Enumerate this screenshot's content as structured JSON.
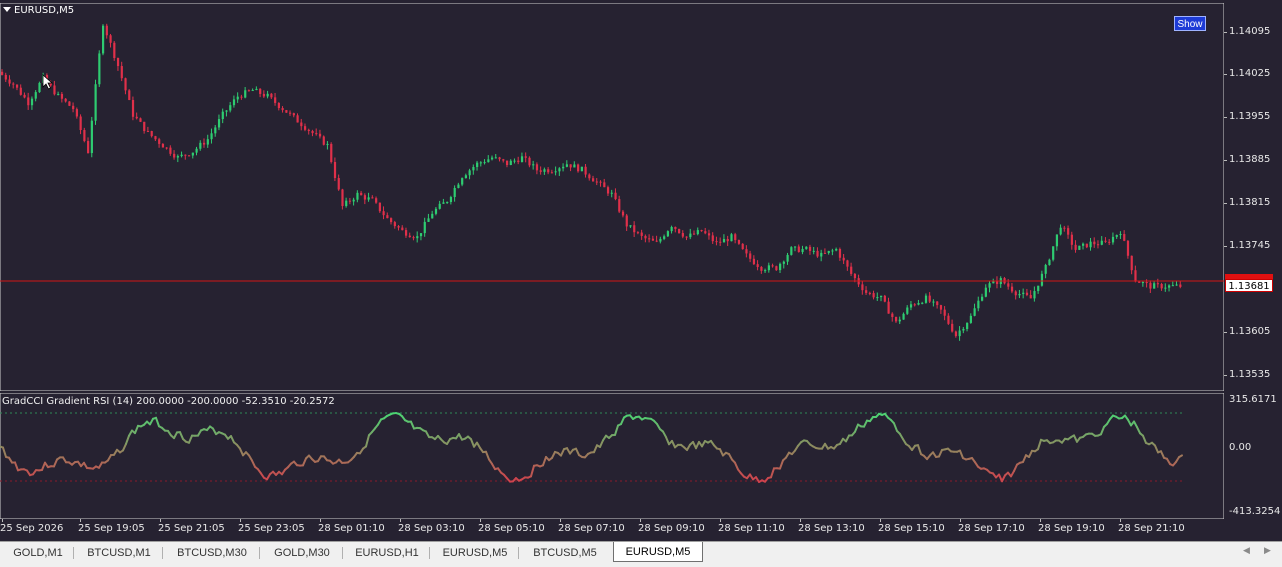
{
  "chart": {
    "title": "EURUSD,M5",
    "show_button": "Show",
    "current_price": "1.13681",
    "bull_color": "#2ecc71",
    "bear_color": "#e0304a",
    "background": "#262231"
  },
  "indicator": {
    "title": "GradCCI Gradient RSI (14) 200.0000 -200.0000 -52.3510 -20.2572",
    "axis_labels": [
      "315.6171",
      "0.00",
      "-413.3254"
    ]
  },
  "price_axis": [
    "1.14095",
    "1.14025",
    "1.13955",
    "1.13885",
    "1.13815",
    "1.13745",
    "1.13605",
    "1.13535"
  ],
  "time_axis": [
    "25 Sep 2026",
    "25 Sep 19:05",
    "25 Sep 21:05",
    "25 Sep 23:05",
    "28 Sep 01:10",
    "28 Sep 03:10",
    "28 Sep 05:10",
    "28 Sep 07:10",
    "28 Sep 09:10",
    "28 Sep 11:10",
    "28 Sep 13:10",
    "28 Sep 15:10",
    "28 Sep 17:10",
    "28 Sep 19:10",
    "28 Sep 21:10"
  ],
  "tabs": [
    "GOLD,M1",
    "BTCUSD,M1",
    "BTCUSD,M30",
    "GOLD,M30",
    "EURUSD,H1",
    "EURUSD,M5",
    "BTCUSD,M5",
    "EURUSD,M5"
  ],
  "active_tab": 7,
  "chart_data": {
    "type": "line",
    "series": [
      {
        "values": [
          1.1403,
          1.1401,
          1.1398,
          1.1402,
          1.1399,
          1.1397,
          1.139,
          1.1411,
          1.1404,
          1.1396,
          1.1393,
          1.1391,
          1.1389,
          1.139,
          1.1392,
          1.1396,
          1.1399,
          1.14,
          1.1399,
          1.1397,
          1.1395,
          1.1393,
          1.1391,
          1.1381,
          1.1383,
          1.1382,
          1.1379,
          1.1377,
          1.1376,
          1.138,
          1.1382,
          1.1386,
          1.1388,
          1.1389,
          1.1388,
          1.1389,
          1.1387,
          1.1387,
          1.1388,
          1.1387,
          1.1385,
          1.1383,
          1.1378,
          1.1376,
          1.1375,
          1.1378,
          1.1376,
          1.1377,
          1.1375,
          1.1376,
          1.1373,
          1.1371,
          1.1371,
          1.1374,
          1.1374,
          1.1373,
          1.1374,
          1.137,
          1.1367,
          1.1366,
          1.1362,
          1.1365,
          1.1366,
          1.1364,
          1.136,
          1.1363,
          1.1368,
          1.1369,
          1.1367,
          1.1366,
          1.1371,
          1.1378,
          1.1374,
          1.1375,
          1.1375,
          1.1377,
          1.1369,
          1.1368,
          1.1368,
          1.1368
        ]
      }
    ]
  }
}
